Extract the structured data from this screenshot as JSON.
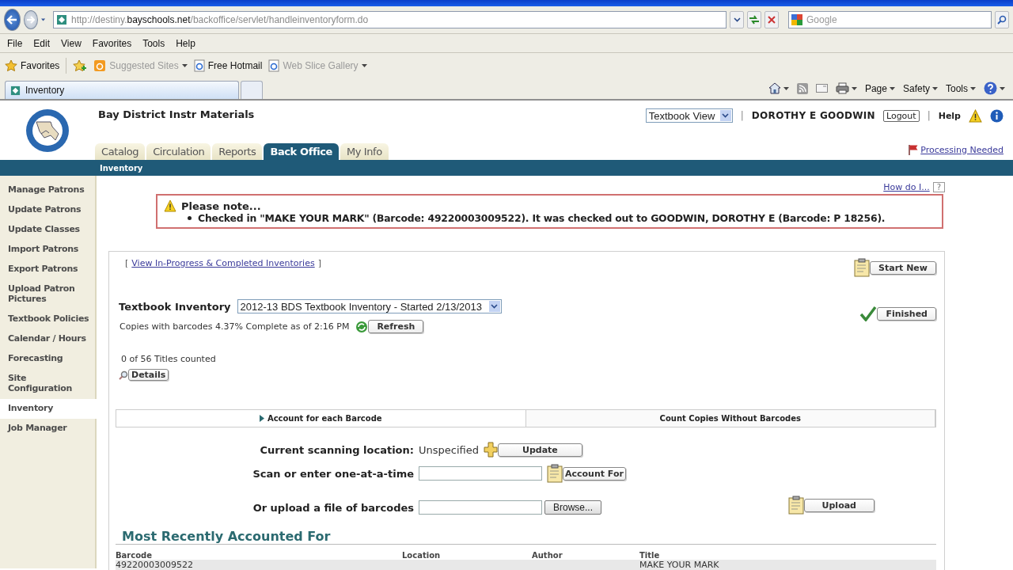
{
  "browser": {
    "url": {
      "prefix": "http://destiny.",
      "domain": "bayschools.net",
      "path": "/backoffice/servlet/handleinventoryform.do"
    },
    "search_placeholder": "Google",
    "menu": [
      "File",
      "Edit",
      "View",
      "Favorites",
      "Tools",
      "Help"
    ],
    "favorites": [
      {
        "label": "Favorites",
        "kind": "star",
        "disabled": false,
        "dropdown": false
      },
      {
        "label": "Suggested Sites",
        "kind": "sites",
        "disabled": true,
        "dropdown": true
      },
      {
        "label": "Free Hotmail",
        "kind": "page",
        "disabled": false,
        "dropdown": false
      },
      {
        "label": "Web Slice Gallery",
        "kind": "page",
        "disabled": true,
        "dropdown": true
      }
    ],
    "tab_title": "Inventory",
    "commands": [
      "Page",
      "Safety",
      "Tools"
    ]
  },
  "header": {
    "site_title": "Bay District Instr Materials",
    "view_select": "Textbook View",
    "separators": [
      "|",
      "|"
    ],
    "user": "DOROTHY E GOODWIN",
    "logout": "Logout",
    "help": "Help",
    "processing_link": "Processing Needed",
    "tabs": [
      {
        "label": "Catalog",
        "selected": false
      },
      {
        "label": "Circulation",
        "selected": false
      },
      {
        "label": "Reports",
        "selected": false
      },
      {
        "label": "Back Office",
        "selected": true
      },
      {
        "label": "My Info",
        "selected": false
      }
    ],
    "subnav": "Inventory"
  },
  "sidebar": {
    "items": [
      {
        "label": "Manage Patrons",
        "selected": false
      },
      {
        "label": "Update Patrons",
        "selected": false
      },
      {
        "label": "Update Classes",
        "selected": false
      },
      {
        "label": "Import Patrons",
        "selected": false
      },
      {
        "label": "Export Patrons",
        "selected": false
      },
      {
        "label": "Upload Patron Pictures",
        "selected": false
      },
      {
        "label": "Textbook Policies",
        "selected": false
      },
      {
        "label": "Calendar / Hours",
        "selected": false
      },
      {
        "label": "Forecasting",
        "selected": false
      },
      {
        "label": "Site Configuration",
        "selected": false
      },
      {
        "label": "Inventory",
        "selected": true
      },
      {
        "label": "Job Manager",
        "selected": false
      }
    ]
  },
  "how_do_i": "How do I...",
  "how_do_i_icon": "?",
  "notice": {
    "title": "Please note...",
    "message": "Checked in \"MAKE YOUR MARK\" (Barcode: 49220003009522). It was checked out to GOODWIN, DOROTHY E (Barcode: P 18256)."
  },
  "inventory": {
    "view_link_open": "[",
    "view_link_close": "]",
    "view_link": "View In-Progress & Completed Inventories",
    "start_new": "Start New",
    "finished": "Finished",
    "label": "Textbook Inventory",
    "select": "2012-13 BDS Textbook Inventory - Started 2/13/2013",
    "status": "Copies with barcodes 4.37% Complete as of 2:16 PM",
    "refresh": "Refresh",
    "titles_counted": "0 of 56 Titles counted",
    "details": "Details",
    "subtabs": [
      {
        "label": "Account for each Barcode",
        "selected": true
      },
      {
        "label": "Count Copies Without Barcodes",
        "selected": false
      }
    ],
    "location_label": "Current scanning location:",
    "location_value": "Unspecified",
    "update": "Update",
    "scan_label": "Scan or enter one-at-a-time",
    "account_for": "Account For",
    "upload_label": "Or upload a file of barcodes",
    "browse": "Browse...",
    "upload": "Upload"
  },
  "recent": {
    "title": "Most Recently Accounted For",
    "columns": [
      "Barcode",
      "Location",
      "Author",
      "Title"
    ],
    "rows": [
      [
        "49220003009522",
        "",
        "",
        "MAKE YOUR MARK"
      ]
    ]
  }
}
